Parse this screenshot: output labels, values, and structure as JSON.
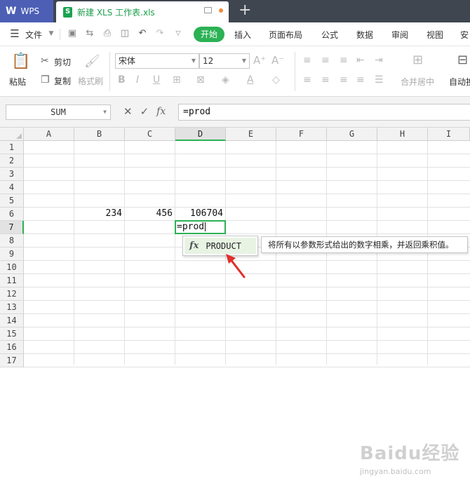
{
  "titlebar": {
    "app_label": "WPS",
    "file_tab": "新建 XLS 工作表.xls"
  },
  "menubar": {
    "file_menu": "文件",
    "tabs": [
      "开始",
      "插入",
      "页面布局",
      "公式",
      "数据",
      "审阅",
      "视图",
      "安"
    ]
  },
  "ribbon": {
    "paste": "粘贴",
    "cut": "剪切",
    "copy": "复制",
    "format_painter": "格式刷",
    "font_name": "宋体",
    "font_size": "12",
    "merge_center": "合并居中",
    "wrap_text": "自动换"
  },
  "formula_bar": {
    "name_box": "SUM",
    "formula": "=prod"
  },
  "grid": {
    "columns": [
      "A",
      "B",
      "C",
      "D",
      "E",
      "F",
      "G",
      "H",
      "I"
    ],
    "rows": [
      "1",
      "2",
      "3",
      "4",
      "5",
      "6",
      "7",
      "8",
      "9",
      "10",
      "11",
      "12",
      "13",
      "14",
      "15",
      "16",
      "17"
    ],
    "active_column": "D",
    "active_row": "7",
    "cells": {
      "B6": "234",
      "C6": "456",
      "D6": "106704",
      "D7": "=prod"
    }
  },
  "autocomplete": {
    "fx_label": "fx",
    "function_name": "PRODUCT",
    "tooltip": "将所有以参数形式给出的数字相乘，并返回乘积值。"
  },
  "watermark": {
    "logo": "Baidu经验",
    "url": "jingyan.baidu.com"
  },
  "colors": {
    "accent_green": "#2cb155",
    "wps_blue": "#4c5fb5",
    "arrow_red": "#e0302a"
  }
}
